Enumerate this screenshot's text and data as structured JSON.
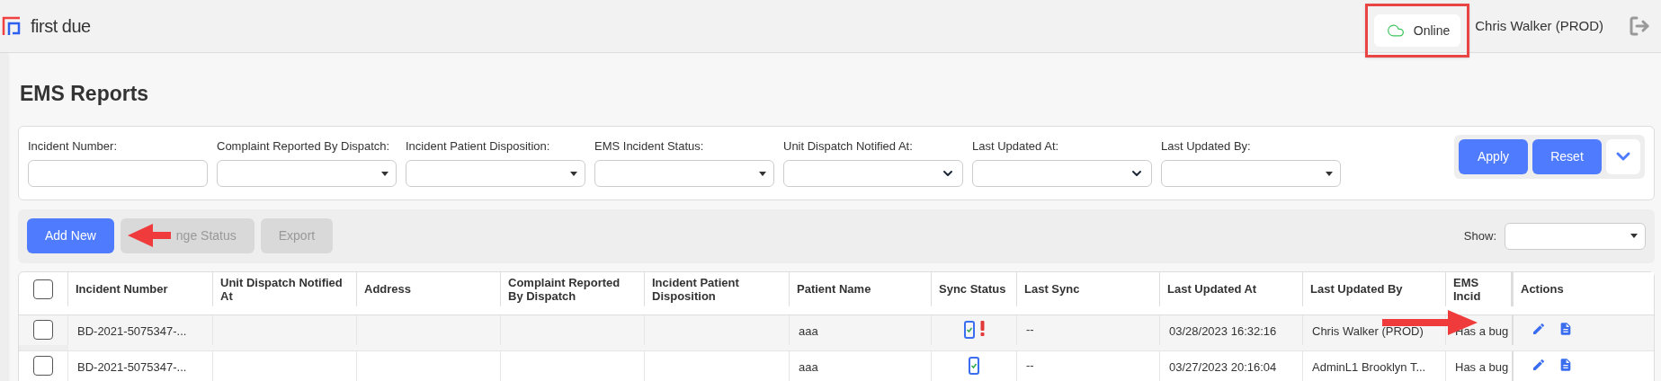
{
  "header": {
    "logo_text": "first due",
    "connection": {
      "label": "Online",
      "online": true
    },
    "user": "Chris Walker (PROD)"
  },
  "page_title": "EMS Reports",
  "filters": [
    {
      "label": "Incident Number:",
      "kind": "text"
    },
    {
      "label": "Complaint Reported By Dispatch:",
      "kind": "select"
    },
    {
      "label": "Incident Patient Disposition:",
      "kind": "select"
    },
    {
      "label": "EMS Incident Status:",
      "kind": "select"
    },
    {
      "label": "Unit Dispatch Notified At:",
      "kind": "native"
    },
    {
      "label": "Last Updated At:",
      "kind": "native"
    },
    {
      "label": "Last Updated By:",
      "kind": "select"
    }
  ],
  "filter_buttons": [
    "Apply",
    "Reset"
  ],
  "toolbar": {
    "buttons": [
      {
        "label": "Add New",
        "disabled": false
      },
      {
        "label": "nge Status",
        "disabled": true
      },
      {
        "label": "Export",
        "disabled": true
      }
    ],
    "show_label": "Show:"
  },
  "table": {
    "all_checked": false,
    "columns": [
      "Incident Number",
      "Unit Dispatch Notified At",
      "Address",
      "Complaint Reported By Dispatch",
      "Incident Patient Disposition",
      "Patient Name",
      "Sync Status",
      "Last Sync",
      "Last Updated At",
      "Last Updated By",
      "EMS Incid",
      "Actions"
    ],
    "rows": [
      {
        "checked": false,
        "highlighted": true,
        "incident_number": "BD-2021-5075347-...",
        "patient_name": "aaa",
        "synced": true,
        "warning": true,
        "last_sync": "--",
        "last_updated_at": "03/28/2023 16:32:16",
        "last_updated_by": "Chris Walker (PROD)",
        "ems_status": "Has a bug"
      },
      {
        "checked": false,
        "highlighted": false,
        "incident_number": "BD-2021-5075347-...",
        "patient_name": "aaa",
        "synced": true,
        "warning": false,
        "last_sync": "--",
        "last_updated_at": "03/27/2023 20:16:04",
        "last_updated_by": "AdminL1 Brooklyn T...",
        "ems_status": "Has a bug"
      }
    ]
  }
}
